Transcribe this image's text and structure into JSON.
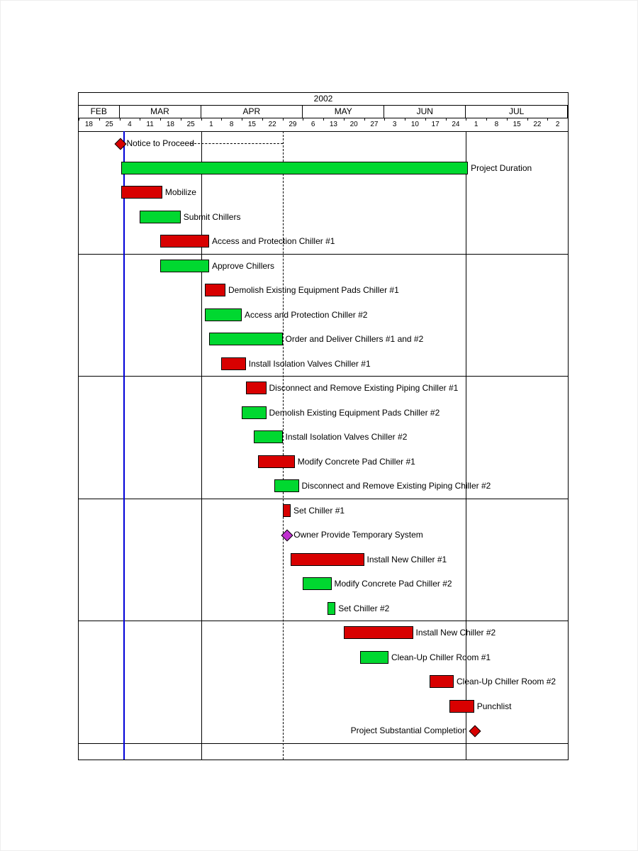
{
  "chart_data": {
    "type": "gantt",
    "title": "2002",
    "months": [
      {
        "label": "FEB",
        "startWeek": 0,
        "endWeek": 2
      },
      {
        "label": "MAR",
        "startWeek": 2,
        "endWeek": 6
      },
      {
        "label": "APR",
        "startWeek": 6,
        "endWeek": 11
      },
      {
        "label": "MAY",
        "startWeek": 11,
        "endWeek": 15
      },
      {
        "label": "JUN",
        "startWeek": 15,
        "endWeek": 19
      },
      {
        "label": "JUL",
        "startWeek": 19,
        "endWeek": 24
      }
    ],
    "weeks": [
      "18",
      "25",
      "4",
      "11",
      "18",
      "25",
      "1",
      "8",
      "15",
      "22",
      "29",
      "6",
      "13",
      "20",
      "27",
      "3",
      "10",
      "17",
      "24",
      "1",
      "8",
      "15",
      "22",
      "2"
    ],
    "nowWeek": 2.2,
    "dashedAt": [
      6,
      10,
      19
    ],
    "solidAt": [
      6,
      19
    ],
    "hlines": [
      5,
      10,
      15,
      20,
      25
    ],
    "tasks": [
      {
        "row": 0,
        "type": "milestone",
        "color": "red",
        "at": 2,
        "label": "Notice to Proceed",
        "labelSide": "right",
        "connectorTo": 10
      },
      {
        "row": 1,
        "type": "bar",
        "color": "green",
        "start": 2.1,
        "end": 19.1,
        "label": "Project Duration",
        "labelSide": "right"
      },
      {
        "row": 2,
        "type": "bar",
        "color": "red",
        "start": 2.1,
        "end": 4.1,
        "label": "Mobilize",
        "labelSide": "right"
      },
      {
        "row": 3,
        "type": "bar",
        "color": "green",
        "start": 3.0,
        "end": 5.0,
        "label": "Submit Chillers",
        "labelSide": "right"
      },
      {
        "row": 4,
        "type": "bar",
        "color": "red",
        "start": 4.0,
        "end": 6.4,
        "label": "Access and Protection Chiller #1",
        "labelSide": "right"
      },
      {
        "row": 5,
        "type": "bar",
        "color": "green",
        "start": 4.0,
        "end": 6.4,
        "label": "Approve Chillers",
        "labelSide": "right"
      },
      {
        "row": 6,
        "type": "bar",
        "color": "red",
        "start": 6.2,
        "end": 7.2,
        "label": "Demolish Existing Equipment Pads Chiller #1",
        "labelSide": "right"
      },
      {
        "row": 7,
        "type": "bar",
        "color": "green",
        "start": 6.2,
        "end": 8.0,
        "label": "Access and Protection Chiller #2",
        "labelSide": "right"
      },
      {
        "row": 8,
        "type": "bar",
        "color": "green",
        "start": 6.4,
        "end": 10.0,
        "label": "Order and Deliver Chillers #1 and #2",
        "labelSide": "right"
      },
      {
        "row": 9,
        "type": "bar",
        "color": "red",
        "start": 7.0,
        "end": 8.2,
        "label": "Install Isolation Valves Chiller #1",
        "labelSide": "right"
      },
      {
        "row": 10,
        "type": "bar",
        "color": "red",
        "start": 8.2,
        "end": 9.2,
        "label": "Disconnect and Remove Existing Piping Chiller #1",
        "labelSide": "right"
      },
      {
        "row": 11,
        "type": "bar",
        "color": "green",
        "start": 8.0,
        "end": 9.2,
        "label": "Demolish Existing Equipment Pads Chiller #2",
        "labelSide": "right"
      },
      {
        "row": 12,
        "type": "bar",
        "color": "green",
        "start": 8.6,
        "end": 10.0,
        "label": "Install Isolation Valves Chiller #2",
        "labelSide": "right"
      },
      {
        "row": 13,
        "type": "bar",
        "color": "red",
        "start": 8.8,
        "end": 10.6,
        "label": "Modify Concrete Pad Chiller #1",
        "labelSide": "right"
      },
      {
        "row": 14,
        "type": "bar",
        "color": "green",
        "start": 9.6,
        "end": 10.8,
        "label": "Disconnect and Remove Existing Piping Chiller #2",
        "labelSide": "right"
      },
      {
        "row": 15,
        "type": "bar",
        "color": "red",
        "start": 10.0,
        "end": 10.4,
        "label": "Set Chiller #1",
        "labelSide": "right"
      },
      {
        "row": 16,
        "type": "milestone",
        "color": "magenta",
        "at": 10.2,
        "label": "Owner Provide Temporary System",
        "labelSide": "right"
      },
      {
        "row": 17,
        "type": "bar",
        "color": "red",
        "start": 10.4,
        "end": 14.0,
        "label": "Install New Chiller #1",
        "labelSide": "right"
      },
      {
        "row": 18,
        "type": "bar",
        "color": "green",
        "start": 11.0,
        "end": 12.4,
        "label": "Modify Concrete Pad Chiller #2",
        "labelSide": "right"
      },
      {
        "row": 19,
        "type": "bar",
        "color": "green",
        "start": 12.2,
        "end": 12.6,
        "label": "Set Chiller #2",
        "labelSide": "right"
      },
      {
        "row": 20,
        "type": "bar",
        "color": "red",
        "start": 13.0,
        "end": 16.4,
        "label": "Install New Chiller #2",
        "labelSide": "right"
      },
      {
        "row": 21,
        "type": "bar",
        "color": "green",
        "start": 13.8,
        "end": 15.2,
        "label": "Clean-Up Chiller Room #1",
        "labelSide": "right"
      },
      {
        "row": 22,
        "type": "bar",
        "color": "red",
        "start": 17.2,
        "end": 18.4,
        "label": "Clean-Up Chiller Room #2",
        "labelSide": "right"
      },
      {
        "row": 23,
        "type": "bar",
        "color": "red",
        "start": 18.2,
        "end": 19.4,
        "label": "Punchlist",
        "labelSide": "right"
      },
      {
        "row": 24,
        "type": "milestone",
        "color": "red",
        "at": 19.4,
        "label": "Project Substantial Completion",
        "labelSide": "left"
      }
    ],
    "rowHeight": 34.5,
    "rowOffset": 8
  }
}
